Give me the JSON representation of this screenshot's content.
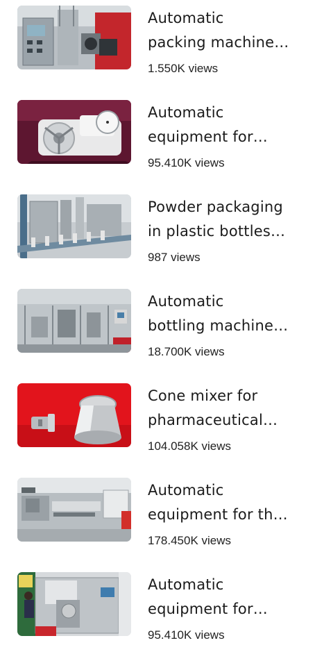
{
  "videos": [
    {
      "title_line1": "Automatic",
      "title_line2": "packing machine…",
      "views": "1.550K views",
      "thumbnail": "packing-machine-icon"
    },
    {
      "title_line1": "Automatic",
      "title_line2": "equipment for…",
      "views": "95.410K views",
      "thumbnail": "tablet-hardness-tester-icon"
    },
    {
      "title_line1": "Powder packaging",
      "title_line2": "in plastic bottles…",
      "views": "987 views",
      "thumbnail": "bottle-conveyor-icon"
    },
    {
      "title_line1": "Automatic",
      "title_line2": "bottling machine…",
      "views": "18.700K views",
      "thumbnail": "bottling-line-icon"
    },
    {
      "title_line1": "Cone mixer for",
      "title_line2": "pharmaceutical…",
      "views": "104.058K views",
      "thumbnail": "cone-mixer-icon"
    },
    {
      "title_line1": "Automatic",
      "title_line2": "equipment for th…",
      "views": "178.450K views",
      "thumbnail": "capsule-machine-icon"
    },
    {
      "title_line1": "Automatic",
      "title_line2": "equipment for…",
      "views": "95.410K views",
      "thumbnail": "capsule-filler-icon"
    }
  ]
}
